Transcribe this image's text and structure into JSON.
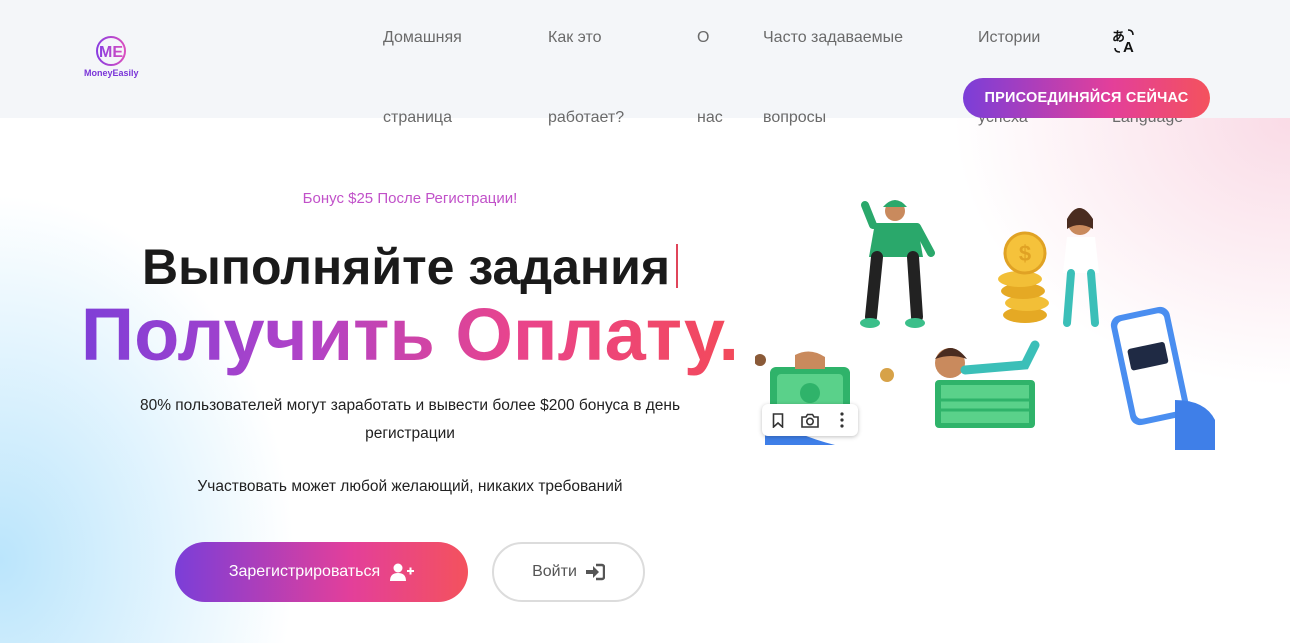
{
  "brand": {
    "name": "MoneyEasily",
    "mark": "ME",
    "accent": "#7b3ed8",
    "accent2": "#f4525d"
  },
  "nav": {
    "items": [
      {
        "line1": "Домашняя",
        "line2": "страница"
      },
      {
        "line1": "Как это",
        "line2": "работает?"
      },
      {
        "line1": "О",
        "line2": "нас"
      },
      {
        "line1": "Часто задаваемые",
        "line2": "вопросы"
      },
      {
        "line1": "Истории",
        "line2": "успеха"
      }
    ],
    "language_icon": "translate-icon",
    "language_label": "Language",
    "join_label": "ПРИСОЕДИНЯЙСЯ СЕЙЧАС"
  },
  "hero": {
    "bonus": "Бонус $25 После Регистрации!",
    "title": "Выполняйте задания",
    "subtitle": "Получить Оплату.",
    "description": "80% пользователей могут заработать и вывести более $200 бонуса в день регистрации",
    "note": "Участвовать может любой желающий, никаких требований",
    "register_label": "Зарегистрироваться",
    "login_label": "Войти"
  },
  "image_toolbar": {
    "icons": [
      "bookmark-icon",
      "camera-icon",
      "more-vertical-icon"
    ]
  }
}
